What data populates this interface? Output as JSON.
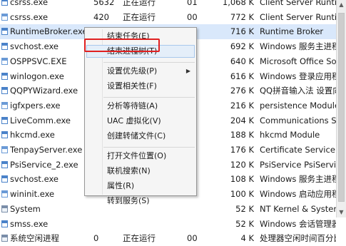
{
  "processes": [
    {
      "name": "csrss.exe",
      "pid": "5632",
      "status": "正在运行",
      "session": "01",
      "memory": "1,068 K",
      "description": "Client Server Runtim",
      "icon": "process-icon"
    },
    {
      "name": "csrss.exe",
      "pid": "420",
      "status": "正在运行",
      "session": "00",
      "memory": "772 K",
      "description": "Client Server Runtim",
      "icon": "process-icon"
    },
    {
      "name": "RuntimeBroker.exe",
      "pid": "",
      "status": "",
      "session": "",
      "memory": "716 K",
      "description": "Runtime Broker",
      "icon": "process-icon",
      "selected": true
    },
    {
      "name": "svchost.exe",
      "pid": "",
      "status": "",
      "session": "",
      "memory": "692 K",
      "description": "Windows 服务主进程",
      "icon": "process-icon"
    },
    {
      "name": "OSPPSVC.EXE",
      "pid": "",
      "status": "",
      "session": "",
      "memory": "640 K",
      "description": "Microsoft Office So",
      "icon": "process-icon"
    },
    {
      "name": "winlogon.exe",
      "pid": "",
      "status": "",
      "session": "",
      "memory": "616 K",
      "description": "Windows 登录应用程",
      "icon": "process-icon"
    },
    {
      "name": "QQPYWizard.exe",
      "pid": "",
      "status": "",
      "session": "",
      "memory": "276 K",
      "description": "QQ拼音输入法 设置向",
      "icon": "process-icon"
    },
    {
      "name": "igfxpers.exe",
      "pid": "",
      "status": "",
      "session": "",
      "memory": "216 K",
      "description": "persistence Module",
      "icon": "process-icon"
    },
    {
      "name": "LiveComm.exe",
      "pid": "",
      "status": "",
      "session": "",
      "memory": "204 K",
      "description": "Communications Se",
      "icon": "process-icon"
    },
    {
      "name": "hkcmd.exe",
      "pid": "",
      "status": "",
      "session": "",
      "memory": "188 K",
      "description": "hkcmd Module",
      "icon": "process-icon"
    },
    {
      "name": "TenpayServer.exe",
      "pid": "",
      "status": "",
      "session": "",
      "memory": "176 K",
      "description": "Certificate Service",
      "icon": "process-icon"
    },
    {
      "name": "PsiService_2.exe",
      "pid": "",
      "status": "",
      "session": "",
      "memory": "120 K",
      "description": "PsiService PsiService",
      "icon": "process-icon"
    },
    {
      "name": "svchost.exe",
      "pid": "",
      "status": "",
      "session": "",
      "memory": "108 K",
      "description": "Windows 服务主进程",
      "icon": "process-icon"
    },
    {
      "name": "wininit.exe",
      "pid": "",
      "status": "",
      "session": "",
      "memory": "100 K",
      "description": "Windows 启动应用程",
      "icon": "process-icon"
    },
    {
      "name": "System",
      "pid": "",
      "status": "",
      "session": "",
      "memory": "52 K",
      "description": "NT Kernel & System",
      "icon": "process-icon"
    },
    {
      "name": "smss.exe",
      "pid": "",
      "status": "",
      "session": "",
      "memory": "52 K",
      "description": "Windows 会话管理器",
      "icon": "process-icon"
    },
    {
      "name": "系统空闲进程",
      "pid": "0",
      "status": "正在运行",
      "session": "00",
      "memory": "4 K",
      "description": "处理器空闲时间百分比",
      "icon": "process-icon"
    }
  ],
  "context_menu": {
    "items": [
      {
        "label": "结束任务(E)",
        "submenu": false
      },
      {
        "label": "结束进程树(T)",
        "submenu": false,
        "highlighted": true
      },
      {
        "separator": true
      },
      {
        "label": "设置优先级(P)",
        "submenu": true
      },
      {
        "label": "设置相关性(F)",
        "submenu": false
      },
      {
        "separator": true
      },
      {
        "label": "分析等待链(A)",
        "submenu": false
      },
      {
        "label": "UAC 虚拟化(V)",
        "submenu": false
      },
      {
        "label": "创建转储文件(C)",
        "submenu": false
      },
      {
        "separator": true
      },
      {
        "label": "打开文件位置(O)",
        "submenu": false
      },
      {
        "label": "联机搜索(N)",
        "submenu": false
      },
      {
        "label": "属性(R)",
        "submenu": false
      },
      {
        "label": "转到服务(S)",
        "submenu": false
      }
    ]
  },
  "scrollbar": {
    "up_icon": "arrow-up-icon",
    "down_icon": "arrow-down-icon"
  },
  "colors": {
    "selected_row": "#d9e8fb",
    "highlight_box": "#e02020",
    "menu_bg": "#f5f5f5"
  }
}
